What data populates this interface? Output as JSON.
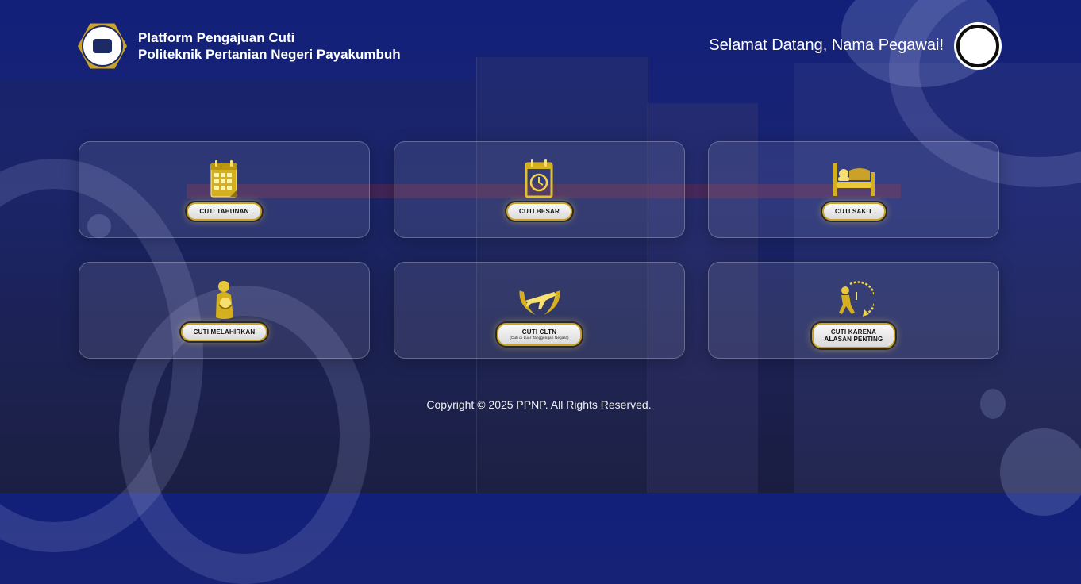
{
  "header": {
    "title_line1": "Platform Pengajuan Cuti",
    "title_line2": "Politeknik Pertanian Negeri Payakumbuh",
    "welcome": "Selamat Datang, Nama Pegawai!"
  },
  "menu": {
    "items": [
      {
        "label": "CUTI TAHUNAN",
        "icon": "calendar-icon"
      },
      {
        "label": "CUTI BESAR",
        "icon": "calendar-clock-icon"
      },
      {
        "label": "CUTI SAKIT",
        "icon": "bed-icon"
      },
      {
        "label": "CUTI MELAHIRKAN",
        "icon": "mother-child-icon"
      },
      {
        "label": "CUTI CLTN",
        "sublabel": "(Cuti di Luar Tanggungan Negara)",
        "icon": "plane-wings-icon"
      },
      {
        "label_line1": "CUTI KARENA",
        "label_line2": "ALASAN PENTING",
        "icon": "person-clock-icon"
      }
    ]
  },
  "footer": {
    "copyright": "Copyright © 2025 PPNP. All Rights Reserved."
  },
  "colors": {
    "accent_gold": "#c9a227",
    "background_navy": "#12207a"
  }
}
